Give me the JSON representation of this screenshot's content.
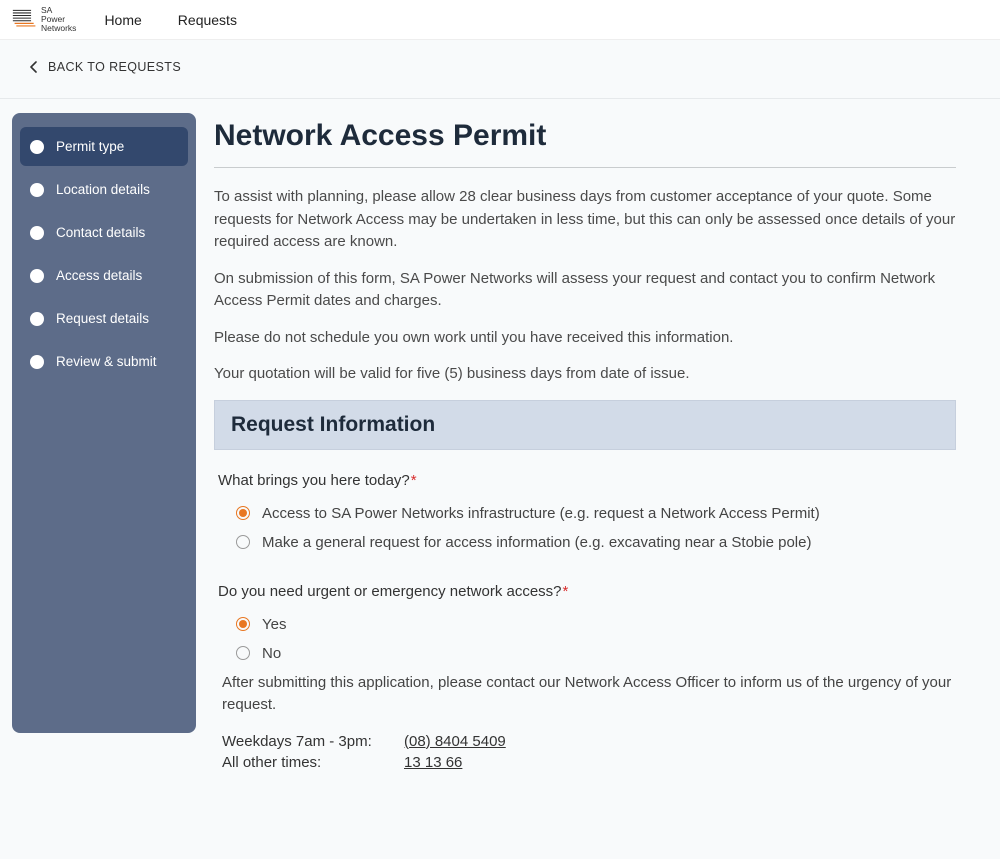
{
  "header": {
    "brand_name": "SA Power Networks",
    "nav": [
      "Home",
      "Requests"
    ]
  },
  "back": {
    "label": "BACK TO REQUESTS"
  },
  "sidebar": {
    "steps": [
      {
        "label": "Permit type",
        "active": true
      },
      {
        "label": "Location details",
        "active": false
      },
      {
        "label": "Contact details",
        "active": false
      },
      {
        "label": "Access details",
        "active": false
      },
      {
        "label": "Request details",
        "active": false
      },
      {
        "label": "Review & submit",
        "active": false
      }
    ]
  },
  "page_title": "Network Access Permit",
  "intro": {
    "p1": "To assist with planning, please allow 28 clear business days from customer acceptance of your quote. Some requests for Network Access may be undertaken in less time, but this can only be assessed once details of your required access are known.",
    "p2": "On submission of this form, SA Power Networks will assess your request and contact you to confirm Network Access Permit dates and charges.",
    "p3": "Please do not schedule you own work until you have received this information.",
    "p4": "Your quotation will be valid for five (5) business days from date of issue."
  },
  "section": {
    "title": "Request Information"
  },
  "form": {
    "q1": {
      "label": "What brings you here today?",
      "options": [
        {
          "label": "Access to SA Power Networks infrastructure (e.g. request a Network Access Permit)",
          "selected": true
        },
        {
          "label": "Make a general request for access information (e.g. excavating near a Stobie pole)",
          "selected": false
        }
      ]
    },
    "q2": {
      "label": "Do you need urgent or emergency network access?",
      "options": [
        {
          "label": "Yes",
          "selected": true
        },
        {
          "label": "No",
          "selected": false
        }
      ],
      "helper": "After submitting this application, please contact our Network Access Officer to inform us of the urgency of your request.",
      "contacts": [
        {
          "label": "Weekdays 7am - 3pm:",
          "value": "(08) 8404 5409"
        },
        {
          "label": "All other times:",
          "value": "13 13 66"
        }
      ]
    }
  }
}
